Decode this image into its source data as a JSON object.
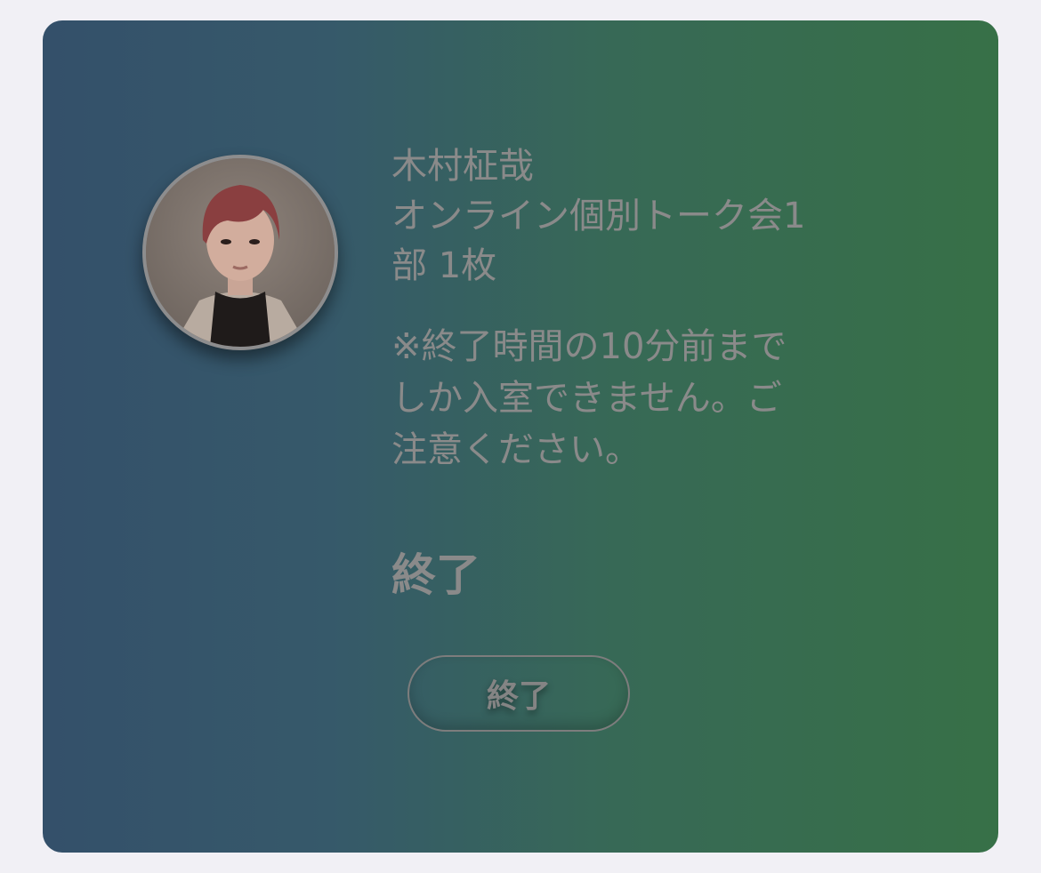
{
  "card": {
    "gradient_start": "#34506a",
    "gradient_end": "#377047"
  },
  "event": {
    "artist": "木村柾哉",
    "title_line1": "オンライン個別トーク会1",
    "title_line2": "部 1枚"
  },
  "notice": {
    "line1": "※終了時間の10分前まで",
    "line2": "しか入室できません。ご",
    "line3": "注意ください。"
  },
  "status": {
    "label": "終了"
  },
  "button": {
    "label": "終了"
  },
  "avatar": {
    "icon": "artist-portrait"
  }
}
